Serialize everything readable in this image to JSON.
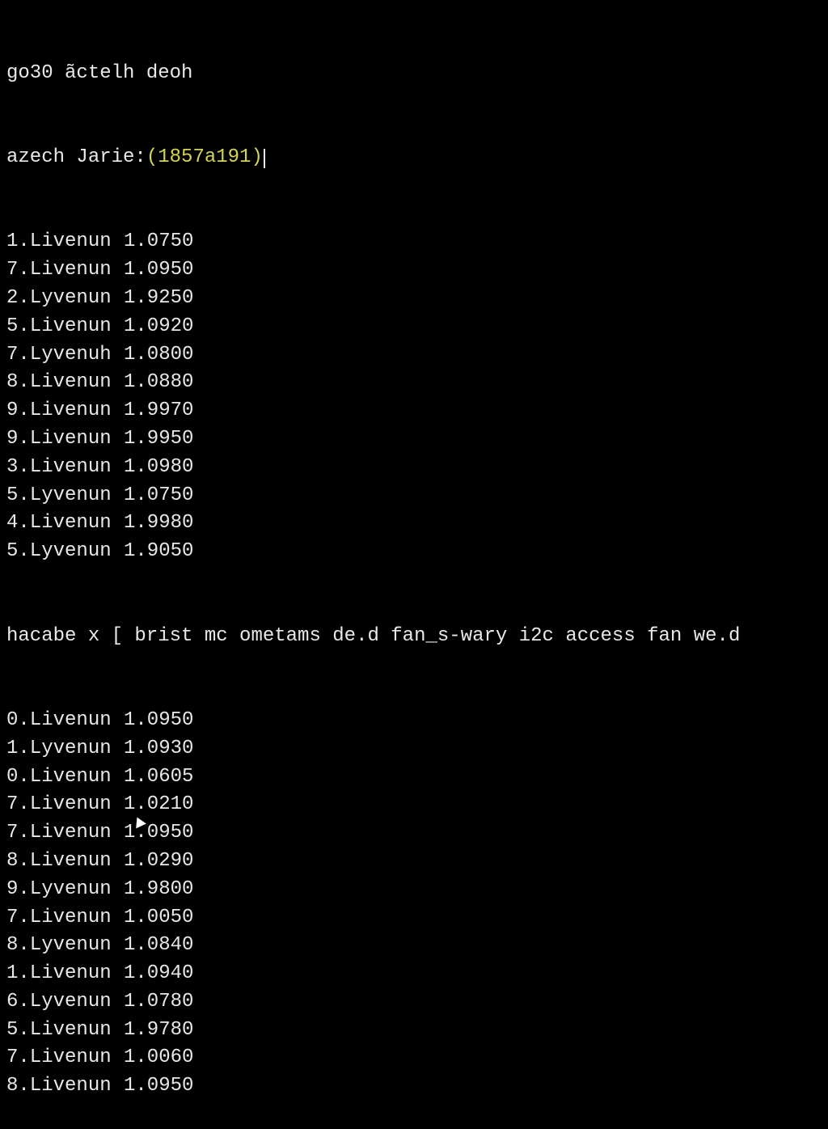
{
  "header": {
    "line1": "go30 ãctelh deoh",
    "promptPrefix": "azech Jarie:",
    "promptValue": "(1857a191)"
  },
  "block1": [
    {
      "label": "1.Livenun",
      "value": "1.0750"
    },
    {
      "label": "7.Livenun",
      "value": "1.0950"
    },
    {
      "label": "2.Lyvenun",
      "value": "1.9250"
    },
    {
      "label": "5.Livenun",
      "value": "1.0920"
    },
    {
      "label": "7.Lyvenuh",
      "value": "1.0800"
    },
    {
      "label": "8.Livenun",
      "value": "1.0880"
    },
    {
      "label": "9.Livenun",
      "value": "1.9970"
    },
    {
      "label": "9.Livenun",
      "value": "1.9950"
    },
    {
      "label": "3.Livenun",
      "value": "1.0980"
    },
    {
      "label": "5.Lyvenun",
      "value": "1.0750"
    },
    {
      "label": "4.Livenun",
      "value": "1.9980"
    },
    {
      "label": "5.Lyvenun",
      "value": "1.9050"
    }
  ],
  "message": "hacabe x [ brist mc ometams de.d fan_s-wary i2c access fan we.d",
  "block2": [
    {
      "label": "0.Livenun",
      "value": "1.0950"
    },
    {
      "label": "1.Lyvenun",
      "value": "1.0930"
    },
    {
      "label": "0.Livenun",
      "value": "1.0605"
    },
    {
      "label": "7.Livenun",
      "value": "1.0210"
    },
    {
      "label": "7.Livenun",
      "value": "1.0950"
    },
    {
      "label": "8.Livenun",
      "value": "1.0290"
    },
    {
      "label": "9.Lyvenun",
      "value": "1.9800"
    },
    {
      "label": "7.Livenun",
      "value": "1.0050"
    },
    {
      "label": "8.Lyvenun",
      "value": "1.0840"
    },
    {
      "label": "1.Livenun",
      "value": "1.0940"
    },
    {
      "label": "6.Lyvenun",
      "value": "1.0780"
    },
    {
      "label": "5.Livenun",
      "value": "1.9780"
    },
    {
      "label": "7.Livenun",
      "value": "1.0060"
    },
    {
      "label": "8.Livenun",
      "value": "1.0950"
    }
  ]
}
